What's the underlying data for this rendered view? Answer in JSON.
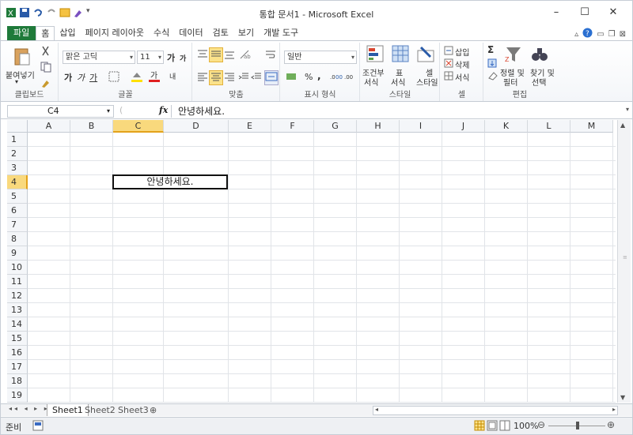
{
  "window": {
    "title": "통합 문서1 - Microsoft Excel"
  },
  "ribbon_tabs": [
    "파일",
    "홈",
    "삽입",
    "페이지 레이아웃",
    "수식",
    "데이터",
    "검토",
    "보기",
    "개발 도구"
  ],
  "ribbon": {
    "clipboard": {
      "label": "클립보드",
      "paste": "붙여넣기"
    },
    "font": {
      "label": "글꼴",
      "font_name": "맑은 고딕",
      "font_size": "11",
      "bold": "가",
      "italic": "가",
      "underline": "가",
      "grow": "가",
      "shrink": "가"
    },
    "alignment": {
      "label": "맞춤"
    },
    "number": {
      "label": "표시 형식",
      "format": "일반",
      "percent": "%",
      "comma": ","
    },
    "styles": {
      "label": "스타일",
      "conditional_line1": "조건부",
      "conditional_line2": "서식",
      "table_line1": "표",
      "table_line2": "서식",
      "cell_line1": "셀",
      "cell_line2": "스타일"
    },
    "cells": {
      "label": "셀",
      "insert": "삽입",
      "delete": "삭제",
      "format": "서식"
    },
    "editing": {
      "label": "편집",
      "sort_line1": "정렬 및",
      "sort_line2": "필터",
      "find_line1": "찾기 및",
      "find_line2": "선택"
    }
  },
  "formula_bar": {
    "name_box": "C4",
    "fx": "fx",
    "content": "안녕하세요."
  },
  "columns": [
    "A",
    "B",
    "C",
    "D",
    "E",
    "F",
    "G",
    "H",
    "I",
    "J",
    "K",
    "L",
    "M"
  ],
  "selected_column": "C",
  "rows": [
    "1",
    "2",
    "3",
    "4",
    "5",
    "6",
    "7",
    "8",
    "9",
    "10",
    "11",
    "12",
    "13",
    "14",
    "15",
    "16",
    "17",
    "18",
    "19"
  ],
  "selected_row": "4",
  "cell_c4": "안녕하세요.",
  "sheets": [
    "Sheet1",
    "Sheet2",
    "Sheet3"
  ],
  "active_sheet": "Sheet1",
  "status": {
    "ready": "준비",
    "zoom": "100%"
  }
}
